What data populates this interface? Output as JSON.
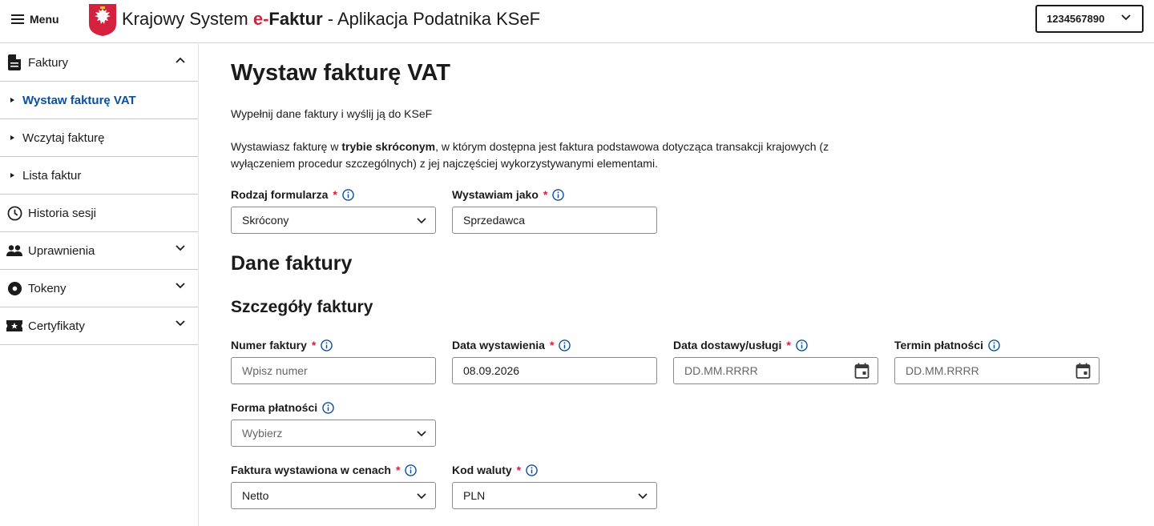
{
  "header": {
    "menu_label": "Menu",
    "title_prefix": "Krajowy System ",
    "title_brand_e": "e-",
    "title_brand_rest": "Faktur",
    "title_suffix": " - Aplikacja Podatnika KSeF",
    "nip_value": "1234567890",
    "accent_color": "#d4213d"
  },
  "sidebar": {
    "items": [
      {
        "label": "Faktury",
        "icon": "document-icon",
        "chevron": "up"
      },
      {
        "label": "Wystaw fakturę VAT",
        "active": true
      },
      {
        "label": "Wczytaj fakturę"
      },
      {
        "label": "Lista faktur"
      },
      {
        "label": "Historia sesji",
        "icon": "clock-icon"
      },
      {
        "label": "Uprawnienia",
        "icon": "people-icon",
        "chevron": "down"
      },
      {
        "label": "Tokeny",
        "icon": "token-icon",
        "chevron": "down"
      },
      {
        "label": "Certyfikaty",
        "icon": "certificate-icon",
        "chevron": "down"
      }
    ],
    "active_color": "#0b4fa0"
  },
  "main": {
    "title": "Wystaw fakturę VAT",
    "intro": "Wypełnij dane faktury i wyślij ją do KSeF",
    "desc_before": "Wystawiasz fakturę w ",
    "desc_bold": "trybie skróconym",
    "desc_after": ", w którym dostępna jest faktura podstawowa dotycząca transakcji krajowych (z wyłączeniem procedur szczególnych) z jej najczęściej wykorzystywanymi elementami.",
    "form_type": {
      "label": "Rodzaj formularza",
      "required": "*",
      "value": "Skrócony"
    },
    "issuer_as": {
      "label": "Wystawiam jako",
      "required": "*",
      "value": "Sprzedawca"
    },
    "section_invoice": "Dane faktury",
    "section_details": "Szczegóły faktury",
    "invoice_number": {
      "label": "Numer faktury",
      "required": "*",
      "placeholder": "Wpisz numer"
    },
    "issue_date": {
      "label": "Data wystawienia",
      "required": "*",
      "value": "08.09.2026"
    },
    "delivery_date": {
      "label": "Data dostawy/usługi",
      "required": "*",
      "placeholder": "DD.MM.RRRR"
    },
    "payment_due": {
      "label": "Termin płatności",
      "placeholder": "DD.MM.RRRR"
    },
    "payment_form": {
      "label": "Forma płatności",
      "placeholder": "Wybierz"
    },
    "price_basis": {
      "label": "Faktura wystawiona w cenach",
      "required": "*",
      "value": "Netto"
    },
    "currency": {
      "label": "Kod waluty",
      "required": "*",
      "value": "PLN"
    }
  }
}
